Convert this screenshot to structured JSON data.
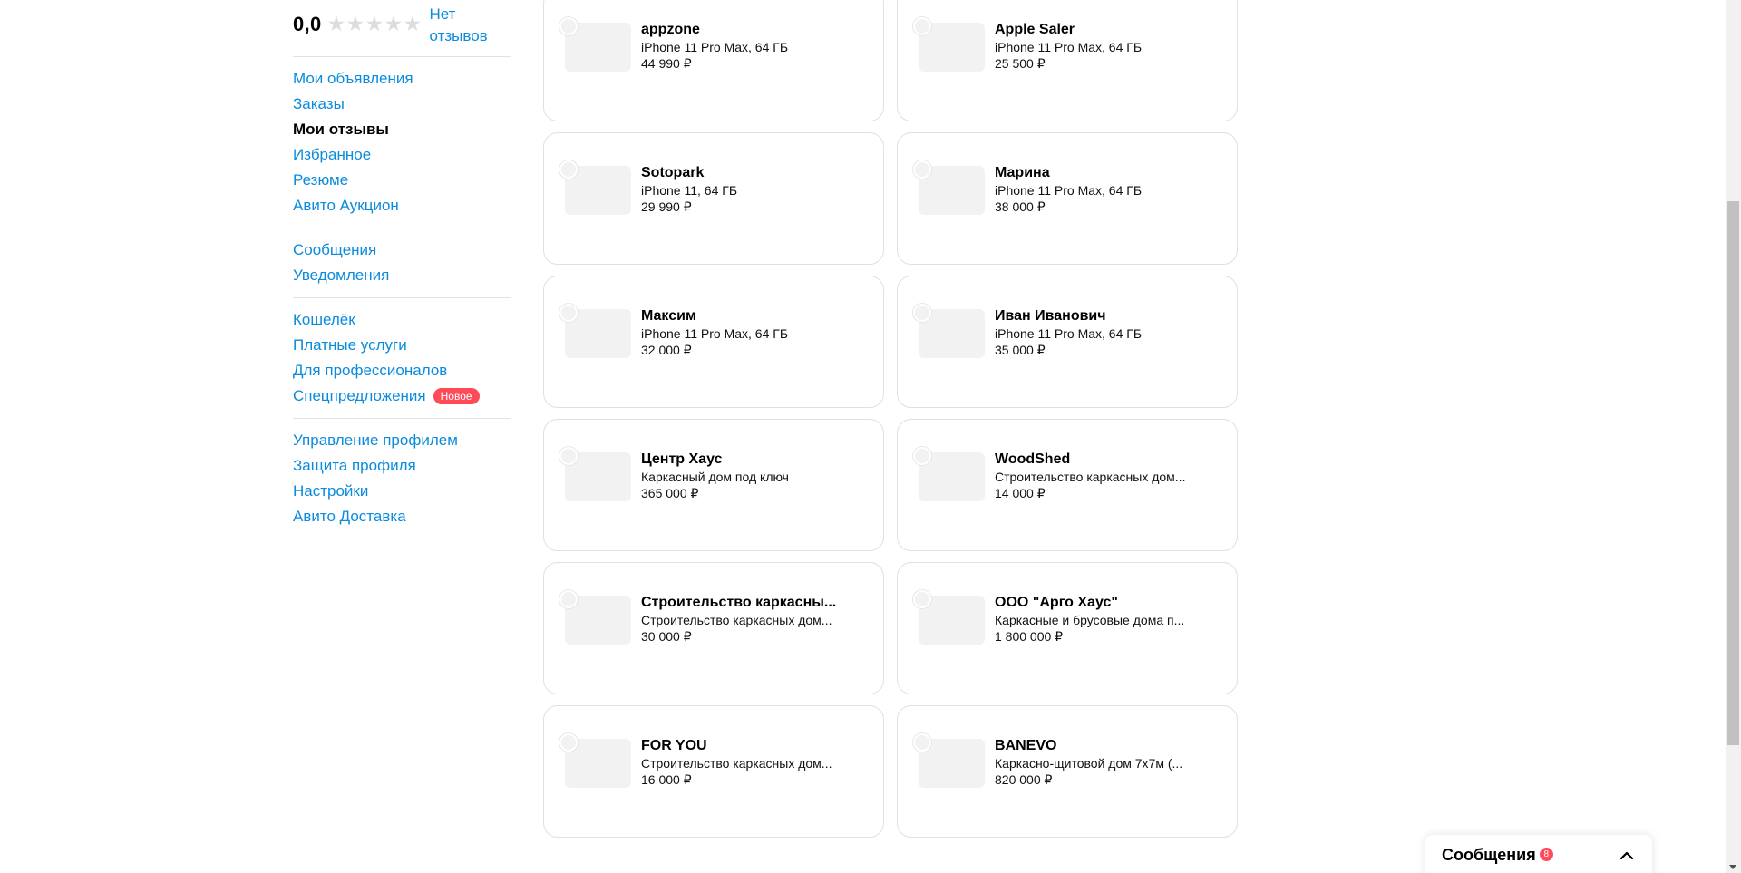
{
  "sidebar": {
    "rating": "0,0",
    "stars_total": 5,
    "stars_filled": 0,
    "no_reviews": "Нет отзывов",
    "groups": [
      [
        {
          "label": "Мои объявления",
          "name": "sidebar-item-my-ads"
        },
        {
          "label": "Заказы",
          "name": "sidebar-item-orders"
        },
        {
          "label": "Мои отзывы",
          "name": "sidebar-item-my-reviews",
          "active": true
        },
        {
          "label": "Избранное",
          "name": "sidebar-item-favorites"
        },
        {
          "label": "Резюме",
          "name": "sidebar-item-resume"
        },
        {
          "label": "Авито Аукцион",
          "name": "sidebar-item-auction"
        }
      ],
      [
        {
          "label": "Сообщения",
          "name": "sidebar-item-messages"
        },
        {
          "label": "Уведомления",
          "name": "sidebar-item-notifications"
        }
      ],
      [
        {
          "label": "Кошелёк",
          "name": "sidebar-item-wallet"
        },
        {
          "label": "Платные услуги",
          "name": "sidebar-item-paid-services"
        },
        {
          "label": "Для профессионалов",
          "name": "sidebar-item-for-professionals"
        },
        {
          "label": "Спецпредложения",
          "name": "sidebar-item-special-offers",
          "badge": "Новое"
        }
      ],
      [
        {
          "label": "Управление профилем",
          "name": "sidebar-item-profile-management"
        },
        {
          "label": "Защита профиля",
          "name": "sidebar-item-profile-protection"
        },
        {
          "label": "Настройки",
          "name": "sidebar-item-settings"
        },
        {
          "label": "Авито Доставка",
          "name": "sidebar-item-avito-delivery"
        }
      ]
    ]
  },
  "cards": [
    {
      "name": "appzone",
      "desc": "iPhone 11 Pro Max, 64 ГБ",
      "price": "44 990 ₽"
    },
    {
      "name": "Apple Saler",
      "desc": "iPhone 11 Pro Max, 64 ГБ",
      "price": "25 500 ₽"
    },
    {
      "name": "Sotopark",
      "desc": "iPhone 11, 64 ГБ",
      "price": "29 990 ₽"
    },
    {
      "name": "Марина",
      "desc": "iPhone 11 Pro Max, 64 ГБ",
      "price": "38 000 ₽"
    },
    {
      "name": "Максим",
      "desc": "iPhone 11 Pro Max, 64 ГБ",
      "price": "32 000 ₽"
    },
    {
      "name": "Иван Иванович",
      "desc": "iPhone 11 Pro Max, 64 ГБ",
      "price": "35 000 ₽"
    },
    {
      "name": "Центр Хаус",
      "desc": "Каркасный дом под ключ",
      "price": "365 000 ₽"
    },
    {
      "name": "WoodShed",
      "desc": "Строительство каркасных дом...",
      "price": "14 000 ₽"
    },
    {
      "name": "Строительство каркасны...",
      "desc": "Строительство каркасных дом...",
      "price": "30 000 ₽"
    },
    {
      "name": "ООО \"Арго Хаус\"",
      "desc": "Каркасные и брусовые дома п...",
      "price": "1 800 000 ₽"
    },
    {
      "name": "FOR YOU",
      "desc": "Строительство каркасных дом...",
      "price": "16 000 ₽"
    },
    {
      "name": "BANEVO",
      "desc": "Каркасно-щитовой дом 7х7м (...",
      "price": "820 000 ₽"
    }
  ],
  "messages_widget": {
    "title": "Сообщения",
    "count": "8",
    "toggle_icon": "chevron-up-icon"
  },
  "colors": {
    "link": "#0a8bdc",
    "badge": "#ff4a58",
    "border": "#e0e0e0",
    "placeholder": "#f2f2f2"
  }
}
